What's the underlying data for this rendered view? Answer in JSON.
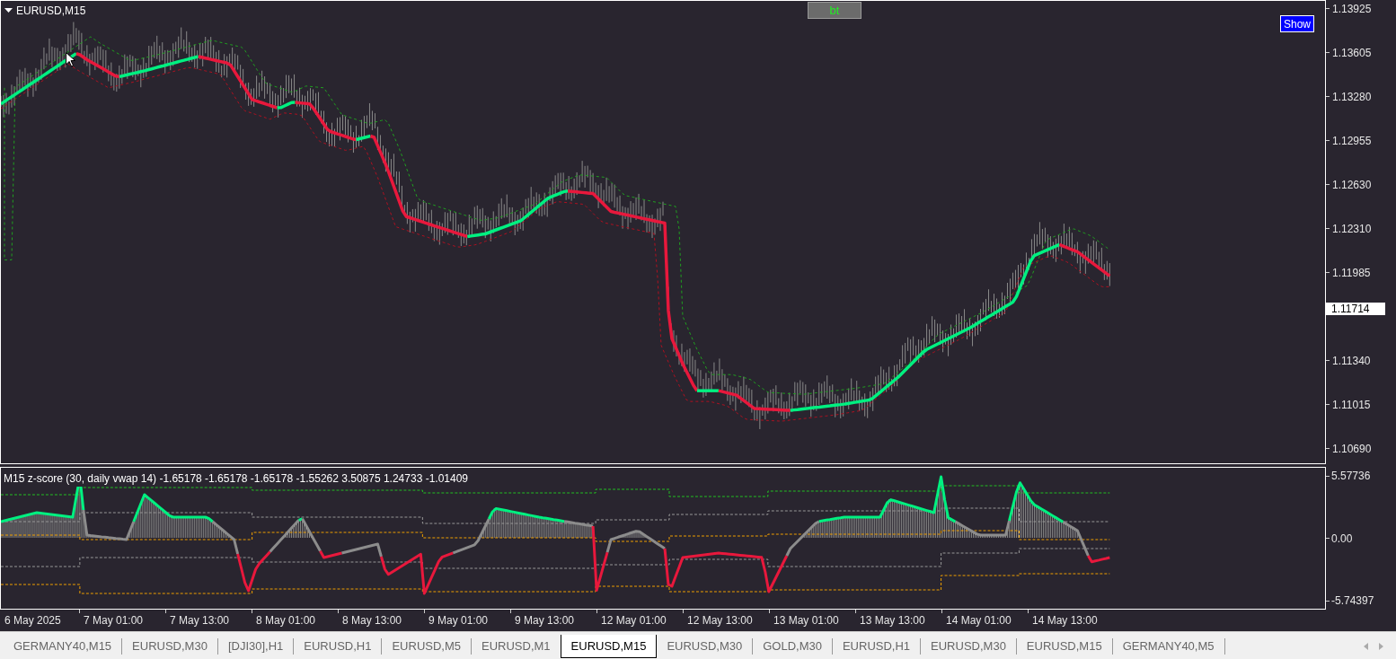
{
  "chart": {
    "symbol": "EURUSD,M15",
    "bt_button": "bt",
    "show_button": "Show",
    "price_axis": [
      "1.13925",
      "1.13605",
      "1.13280",
      "1.12955",
      "1.12630",
      "1.12310",
      "1.11985",
      "1.11340",
      "1.11015",
      "1.10690"
    ],
    "current_price": "1.11714"
  },
  "indicator": {
    "label": "M15 z-score (30, daily vwap 14) -1.65178 -1.65178 -1.65178 -1.55262 3.50875 1.24733 -1.01409",
    "axis": [
      "5.57736",
      "0.00",
      "-5.74397"
    ]
  },
  "time_axis": [
    "6 May 2025",
    "7 May 01:00",
    "7 May 13:00",
    "8 May 01:00",
    "8 May 13:00",
    "9 May 01:00",
    "9 May 13:00",
    "12 May 01:00",
    "12 May 13:00",
    "13 May 01:00",
    "13 May 13:00",
    "14 May 01:00",
    "14 May 13:00"
  ],
  "tabs": [
    {
      "label": "GERMANY40,M15",
      "selected": false
    },
    {
      "label": "EURUSD,M30",
      "selected": false
    },
    {
      "label": "[DJI30],H1",
      "selected": false
    },
    {
      "label": "EURUSD,H1",
      "selected": false
    },
    {
      "label": "EURUSD,M5",
      "selected": false
    },
    {
      "label": "EURUSD,M1",
      "selected": false
    },
    {
      "label": "EURUSD,M15",
      "selected": true
    },
    {
      "label": "EURUSD,M30",
      "selected": false
    },
    {
      "label": "GOLD,M30",
      "selected": false
    },
    {
      "label": "EURUSD,H1",
      "selected": false
    },
    {
      "label": "EURUSD,M30",
      "selected": false
    },
    {
      "label": "EURUSD,M15",
      "selected": false
    },
    {
      "label": "GERMANY40,M5",
      "selected": false
    }
  ]
}
